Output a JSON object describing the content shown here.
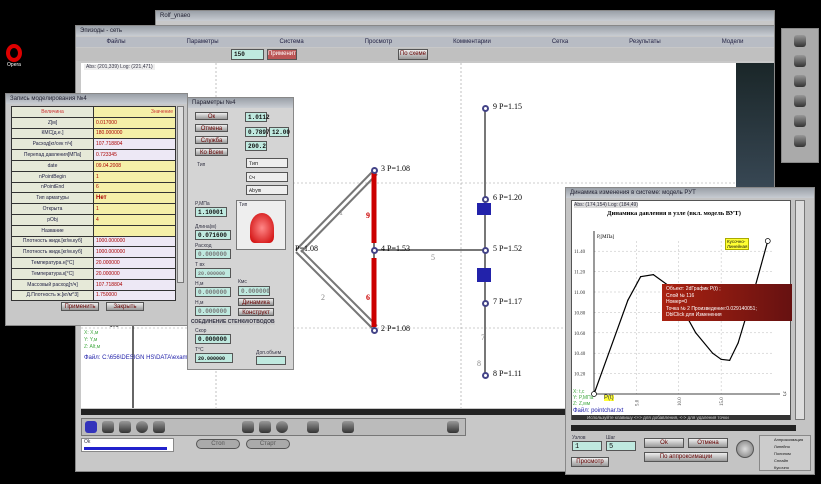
{
  "desktop": {
    "opera_label": "Opera"
  },
  "back_window": {
    "title": "Rolf_ynaeo"
  },
  "main_window": {
    "title": "Эпизоды - сеть",
    "menu": [
      "Файлы",
      "Параметры",
      "Система",
      "Просмотр",
      "Комментарии",
      "Сетка",
      "Результаты",
      "Модели"
    ],
    "toolbar": {
      "scale_value": "150",
      "apply_label": "Применить",
      "by_scheme_label": "По схеме"
    },
    "status": "Abs: (201,339) Log: (221,471)",
    "coords": [
      "X: X,м",
      "Y: Y,м",
      "Z: Alt,м"
    ],
    "axis_value": "1.0",
    "file_path": "Файл: C:\\656\\DESIGN HS\\DATA\\examples\\hs_models\\org.hsp",
    "progress_label": "Ok",
    "progress": 0.95,
    "bottom_buttons": [
      "Стоп",
      "Старт"
    ]
  },
  "diagram": {
    "nodes": [
      {
        "label": "9 P=1.15"
      },
      {
        "label": "3 P=1.08"
      },
      {
        "label": "6 P=1.20"
      },
      {
        "label": "P=1.08"
      },
      {
        "label": "4 P=1.53"
      },
      {
        "label": "5 P=1.52"
      },
      {
        "label": "7 P=1.17"
      },
      {
        "label": "2 P=1.08"
      },
      {
        "label": "8 P=1.11"
      }
    ],
    "edge_labels": [
      "1",
      "2",
      "5",
      "6",
      "7",
      "8",
      "9"
    ]
  },
  "left_dialog": {
    "title": "Запись моделирования №4",
    "header": [
      "Величина",
      "Значение"
    ],
    "rows": [
      [
        "Z[м]",
        "0.017000"
      ],
      [
        "КМС[д.е.]",
        "180.000000"
      ],
      [
        "Расход[кг/сек т/ч]",
        "107.718804"
      ],
      [
        "Перепад давления[МПа]",
        "0.723345"
      ],
      [
        "date",
        "09.04.2008"
      ],
      [
        "nPointBegin",
        "1"
      ],
      [
        "nPointEnd",
        "6"
      ],
      [
        "Тип арматуры",
        "Нет"
      ],
      [
        "Открыта",
        "1"
      ],
      [
        "pObj",
        "4"
      ],
      [
        "Название",
        ""
      ],
      [
        "Плотность жидк.[кг/м.куб]",
        "1000.000000"
      ],
      [
        "Плотность жидк.[кг/м.куб]",
        "1000.000000"
      ],
      [
        "Температура.н[°C]",
        "20.000000"
      ],
      [
        "Температура.к[°C]",
        "20.000000"
      ],
      [
        "Массовый расход[т/ч]",
        "107.718804"
      ],
      [
        "Д.Плотность ж.[кг/м^3]",
        "1.750000"
      ]
    ],
    "buttons": [
      "Применить",
      "Закрыть"
    ]
  },
  "mid_panel": {
    "title": "Параметры №4",
    "buttons": [
      "Ок",
      "Отмена",
      "Служба",
      "Ко Всем"
    ],
    "fields": {
      "x": "1.0112",
      "y": "0.7897",
      "z": "200.2",
      "diam": "12.00"
    },
    "selects": [
      "Тип",
      "Сч",
      "Abym"
    ],
    "type_label": "Тип",
    "p_label": "P,МПа",
    "p_value": "1.10001",
    "len_label": "Длина(м)",
    "len_value": "0.071600",
    "f3_label": "Расход",
    "f3_value": "0.000000",
    "f4_label": "Т вх",
    "f4_value": "20.000000",
    "f5_label": "Н,м",
    "f5_value": "0.000000",
    "f6_label": "Н,м",
    "f6_value": "0.000000",
    "f7_label": "Кмс",
    "f7_value": "0.000000",
    "pic_label": "Тип",
    "dyn_label": "Динамика",
    "const_label": "Конструкт",
    "banner": "СОЕДИНЕНИЕ СТЕНКИ/ОТВОДОВ",
    "speed_label": "Скор",
    "speed_value": "0.000000",
    "temp_label": "Т°С",
    "temp_value": "20.000000",
    "extra_label": "Доп.объем"
  },
  "chart_window": {
    "title": "Динамика изменения в системе: модель РУТ",
    "status": "Abs: (174,154) Log: (184,49)",
    "tooltip": [
      "Объект: 2dГрафик P(t) ;",
      "Слой № 116",
      "Номер=0",
      "Точка № 2 Произведение:0.029140051;",
      "DblClick для Изменения"
    ],
    "hint": "Используйте клавишу <+> для добавления, <-> для удаления точки",
    "file": "Файл: pointchar.txt",
    "fields": [
      {
        "label": "Узлов",
        "value": "1"
      },
      {
        "label": "Шаг",
        "value": "5"
      }
    ],
    "buttons": [
      "Ok",
      "Отмена",
      "По аппроксимации",
      "Просмотр"
    ],
    "legend_items": [
      "Аппроксимация",
      "Линейно",
      "Полином",
      "Сплайн",
      "Кусочно"
    ]
  },
  "chart_data": {
    "type": "line",
    "title": "Динамика давления в узле (вкл. модель ВУТ)",
    "ylabel": "P,[МПа]",
    "xlabel": "t,c",
    "x": [
      0,
      4,
      5.5,
      7,
      9,
      12,
      14,
      15,
      16,
      17,
      19,
      20.5
    ],
    "y": [
      10.0,
      10.92,
      11.15,
      11.17,
      11.05,
      10.6,
      10.4,
      10.34,
      10.33,
      10.5,
      11.05,
      11.5
    ],
    "xticks": [
      "5.0",
      "10.0",
      "15.0"
    ],
    "yticks": [
      "10.20",
      "10.40",
      "10.60",
      "10.80",
      "11.00",
      "11.20",
      "11.40"
    ],
    "xlim": [
      0,
      21
    ],
    "ylim": [
      10.0,
      11.5
    ],
    "legend": [
      "Кусочно-",
      "Линейная"
    ],
    "point_label": "P(t)",
    "xyz": [
      "X: t,c",
      "Y: P,МПа",
      "Z: Z,мм"
    ],
    "grid": true
  }
}
